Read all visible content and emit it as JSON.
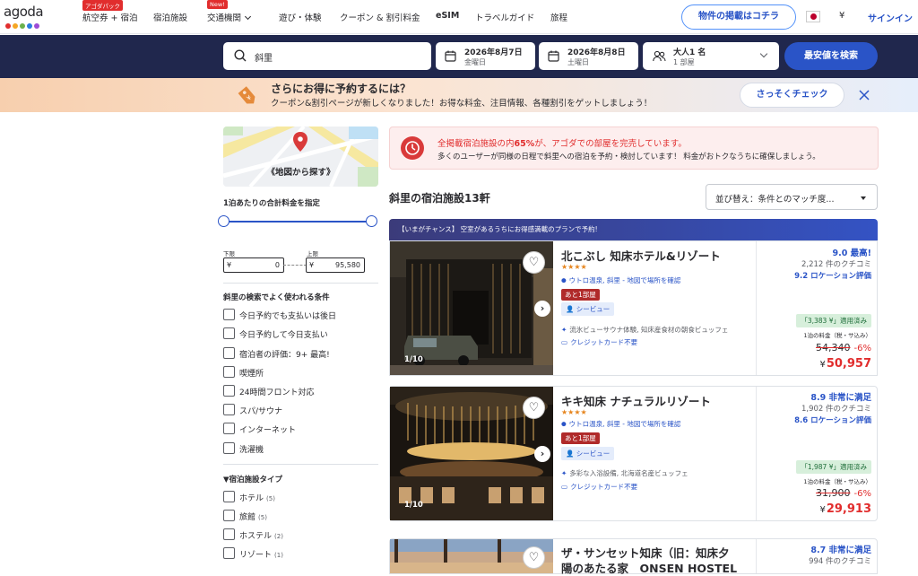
{
  "nav": {
    "logo": "agoda",
    "logo_colors": [
      "#e12d2d",
      "#f5a623",
      "#6bb14c",
      "#2a7de1",
      "#9c4cd6"
    ],
    "items": [
      {
        "label": "航空券 + 宿泊",
        "badge": "アゴダパック"
      },
      {
        "label": "宿泊施設"
      },
      {
        "label": "交通機関",
        "badge": "New!"
      },
      {
        "label": "遊び・体験"
      },
      {
        "label": "クーポン & 割引料金"
      },
      {
        "label": "eSIM"
      },
      {
        "label": "トラベルガイド"
      },
      {
        "label": "旅程"
      }
    ],
    "list_property": "物件の掲載はコチラ",
    "currency": "¥",
    "sign_in": "サインイン"
  },
  "search": {
    "destination": "斜里",
    "checkin_date": "2026年8月7日",
    "checkin_day": "金曜日",
    "checkout_date": "2026年8月8日",
    "checkout_day": "土曜日",
    "guests": "大人1 名",
    "rooms": "1 部屋",
    "button": "最安値を検索"
  },
  "promo": {
    "title": "さらにお得に予約するには？",
    "subtitle": "クーポン&割引ページが新しくなりました！お得な料金、注目情報、各種割引をゲットしましょう！",
    "button": "さっそくチェック"
  },
  "sidebar": {
    "map_label": "《地図から探す》",
    "price_title": "1泊あたりの合計料金を指定",
    "min_label": "下限",
    "max_label": "上限",
    "min_currency": "¥",
    "max_currency": "¥",
    "min_value": "0",
    "max_value": "95,580",
    "popular_title": "斜里の検索でよく使われる条件",
    "popular": [
      "今日予約でも支払いは後日",
      "今日予約して今日支払い",
      "宿泊者の評価：9+ 最高!",
      "喫煙所",
      "24時間フロント対応",
      "スパ/サウナ",
      "インターネット",
      "洗濯機"
    ],
    "type_title": "▼宿泊施設タイプ",
    "types": [
      {
        "label": "ホテル",
        "count": "(5)"
      },
      {
        "label": "旅館",
        "count": "(5)"
      },
      {
        "label": "ホステル",
        "count": "(2)"
      },
      {
        "label": "リゾート",
        "count": "(1)"
      }
    ]
  },
  "alert": {
    "line1_prefix": "全掲載宿泊施設の内",
    "line1_pct": "65%",
    "line1_suffix": "が、アゴダでの部屋を完売しています。",
    "line2": "多くのユーザーが同様の日程で斜里への宿泊を予約・検討しています！ 料金がおトクなうちに確保しましょう。"
  },
  "results": {
    "count_label": "斜里の宿泊施設13軒",
    "sort_label": "並び替え：条件とのマッチ度...",
    "banner": "【いまがチャンス】 空室があるうちにお得感満載のプランで予約!"
  },
  "hotels": [
    {
      "name": "北こぶし 知床ホテル&リゾート",
      "stars": "★★★★",
      "location": "ウトロ温泉, 斜里 - 地図で場所を確認",
      "urgency": "あと1部屋",
      "view": "シービュー",
      "feature1": "流氷ビューサウナ体験, 知床産食材の朝食ビュッフェ",
      "feature2": "クレジットカード不要",
      "photos": "1/10",
      "score": "9.0 最高!",
      "reviews": "2,212 件のクチコミ",
      "location_score": "9.2 ロケーション評価",
      "coupon": "「3,383 ¥」適用済み",
      "per_night": "1泊の料金（税・サ込み）",
      "old_price": "54,340",
      "discount": "-6%",
      "currency": "¥",
      "price": "50,957"
    },
    {
      "name": "キキ知床 ナチュラルリゾート",
      "stars": "★★★★",
      "location": "ウトロ温泉, 斜里 - 地図で場所を確認",
      "urgency": "あと1部屋",
      "view": "シービュー",
      "feature1": "多彩な入浴設備, 北海道名産ビュッフェ",
      "feature2": "クレジットカード不要",
      "photos": "1/10",
      "score": "8.9 非常に満足",
      "reviews": "1,902 件のクチコミ",
      "location_score": "8.6 ロケーション評価",
      "coupon": "「1,987 ¥」適用済み",
      "per_night": "1泊の料金（税・サ込み）",
      "old_price": "31,900",
      "discount": "-6%",
      "currency": "¥",
      "price": "29,913"
    },
    {
      "name_line1": "ザ・サンセット知床（旧：知床夕",
      "name_line2": "陽のあたる家　ONSEN HOSTEL",
      "score": "8.7 非常に満足",
      "reviews": "994 件のクチコミ"
    }
  ]
}
